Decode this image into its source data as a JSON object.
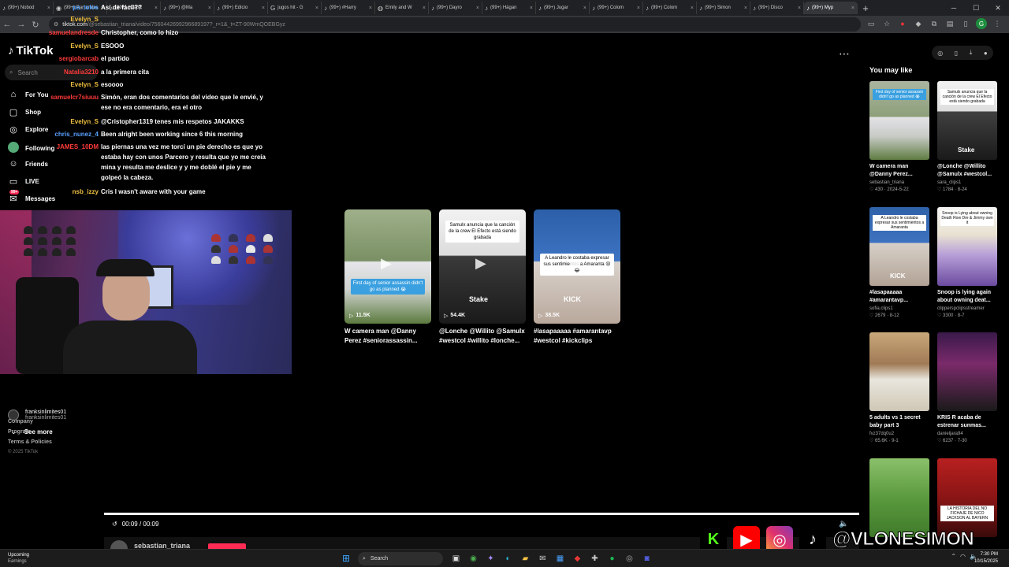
{
  "browser": {
    "tabs": [
      {
        "label": "(99+) Nobod",
        "icon": "tiktok-icon"
      },
      {
        "label": "(99+) Parrandas",
        "icon": "chrome-icon"
      },
      {
        "label": "(99+) #CapC",
        "icon": "tiktok-icon"
      },
      {
        "label": "(99+) @Ma",
        "icon": "tiktok-icon"
      },
      {
        "label": "(99+) Edicio",
        "icon": "tiktok-icon"
      },
      {
        "label": "jugos hit - G",
        "icon": "google-icon"
      },
      {
        "label": "(99+) #Harry",
        "icon": "tiktok-icon"
      },
      {
        "label": "Emily and W",
        "icon": "globe-icon"
      },
      {
        "label": "(99+) Dayro",
        "icon": "tiktok-icon"
      },
      {
        "label": "(99+) Hágan",
        "icon": "tiktok-icon"
      },
      {
        "label": "(99+) Jugar",
        "icon": "tiktok-icon"
      },
      {
        "label": "(99+) Colom",
        "icon": "tiktok-icon"
      },
      {
        "label": "(99+) Colom",
        "icon": "tiktok-icon"
      },
      {
        "label": "(99+) Simon",
        "icon": "tiktok-icon"
      },
      {
        "label": "(99+) Disco",
        "icon": "tiktok-icon"
      },
      {
        "label": "(99+) Myp",
        "icon": "tiktok-icon"
      }
    ],
    "new_tab": "+",
    "url_domain": "tiktok.com",
    "url_rest": "/@sebastian_triana/video/7560442699296689197?_r=1&_t=ZT-90WmQOEBGyz"
  },
  "tiktok": {
    "logo": "TikTok",
    "search_placeholder": "Search",
    "nav": [
      {
        "label": "For You",
        "icon": "home-icon"
      },
      {
        "label": "Shop",
        "icon": "shop-icon"
      },
      {
        "label": "Explore",
        "icon": "compass-icon"
      },
      {
        "label": "Following",
        "icon": "following-icon"
      },
      {
        "label": "Friends",
        "icon": "friends-icon"
      },
      {
        "label": "LIVE",
        "icon": "live-icon"
      },
      {
        "label": "Messages",
        "icon": "messages-icon",
        "badge": "99+"
      }
    ],
    "creator_name": "franksinlimites01",
    "creator_handle": "franksinlimites01",
    "see_more": "See more",
    "footer": [
      "Company",
      "Program",
      "Terms & Policies"
    ],
    "copyright": "© 2025 TikTok"
  },
  "chat": [
    {
      "user": "pa_tolos",
      "text": "Así de fácil??",
      "color": "#4a9eff"
    },
    {
      "user": "Evelyn_S",
      "text": "",
      "color": "#f0c040"
    },
    {
      "user": "samuelandresde",
      "text": "Christopher, como lo hizo",
      "color": "#ff3a3a"
    },
    {
      "user": "Evelyn_S",
      "text": "ESOOO",
      "color": "#f0c040"
    },
    {
      "user": "sergiobarcab",
      "text": "el partido",
      "color": "#ff3a3a"
    },
    {
      "user": "Natalia3210",
      "text": "a la primera cita",
      "color": "#ff3a3a"
    },
    {
      "user": "Evelyn_S",
      "text": "esoooo",
      "color": "#f0c040"
    },
    {
      "user": "samuelcr7siuuu",
      "text": "Simón, eran dos comentarios del video que le envié, y ese no era comentario, era el otro",
      "color": "#ff3a3a"
    },
    {
      "user": "Evelyn_S",
      "text": "@Cristopher1319 tenes mis respetos JAKAKKS",
      "color": "#f0c040"
    },
    {
      "user": "chris_nunez_4",
      "text": "Been alright been working since 6 this morning",
      "color": "#5aa0ff"
    },
    {
      "user": "JAMES_10DM",
      "text": "las piernas una vez me torcí un pie derecho es que yo estaba hay con unos Parcero y resulta que yo me creía mina y resulta me deslice y y me doblé el pie y me golpeó la cabeza.",
      "color": "#ff3a3a"
    },
    {
      "user": "nsb_izzy",
      "text": "Cris I wasn't aware with your game",
      "color": "#f0c040"
    }
  ],
  "videos": [
    {
      "views": "11.5K",
      "title": "W camera man @Danny Perez #seniorassassin...",
      "caption": "First day of senior assassin didn't go as planned 😭"
    },
    {
      "views": "54.4K",
      "title": "@Lonche @Willito @Samulx #westcol #willito #lonche...",
      "caption": "Samulx anuncia que la canción de la crew El Efecto está siendo grabada",
      "brand": "Stake"
    },
    {
      "views": "38.5K",
      "title": "#lasapaaaaa #amarantavp #westcol #kickclips",
      "caption": "A Leandro le costaba expresar sus sentimientos a Amaranta 😢😂",
      "brand": "KICK"
    }
  ],
  "player": {
    "time": "00:09 / 00:09",
    "author": "sebastian_triana"
  },
  "right": {
    "heading": "You may like",
    "cards": [
      {
        "title": "W camera man @Danny Perez...",
        "author": "sebastian_triana",
        "likes": "430",
        "date": "2024-5-22",
        "caption": "First day of senior assassin didn't go as planned 😭"
      },
      {
        "title": "@Lonche @Willito @Samulx #westcol...",
        "author": "sara_clips1",
        "likes": "1784",
        "date": "8-24",
        "caption": "Samulx anuncia que la canción de la crew El Efecto está siendo grabada",
        "brand": "Stake"
      },
      {
        "title": "#lasapaaaaa #amarantavp...",
        "author": "sofia.clips1",
        "likes": "2679",
        "date": "8-12",
        "caption": "A Leandro le costaba expresar sus sentimientos a Amaranta",
        "brand": "KICK"
      },
      {
        "title": "Snoop is lying again about owning deat...",
        "author": "clipperspclipsstreamer",
        "likes": "3300",
        "date": "8-7",
        "caption": "Snoop is Lying about owning Death Row Dre & Jimmy own it"
      },
      {
        "title": "5 adults vs 1 secret baby part 3",
        "author": "fvz37dq0u2",
        "likes": "65.6K",
        "date": "9-1",
        "caption": ""
      },
      {
        "title": "KRIS R acaba de estrenar sunmas...",
        "author": "danieljara94",
        "likes": "6237",
        "date": "7-30",
        "caption": ""
      },
      {
        "title": "",
        "author": "",
        "likes": "",
        "date": "",
        "caption": ""
      },
      {
        "title": "",
        "author": "",
        "likes": "",
        "date": "",
        "caption": "LA HISTORIA DEL NO FICHAJE DE NICO JACKSON AL BAYERN"
      }
    ]
  },
  "watermark": {
    "handle": "@VLONESIMON"
  },
  "taskbar": {
    "weather_title": "Upcoming",
    "weather_sub": "Earnings",
    "search": "Search",
    "time": "7:30 PM",
    "date": "10/15/2025"
  }
}
